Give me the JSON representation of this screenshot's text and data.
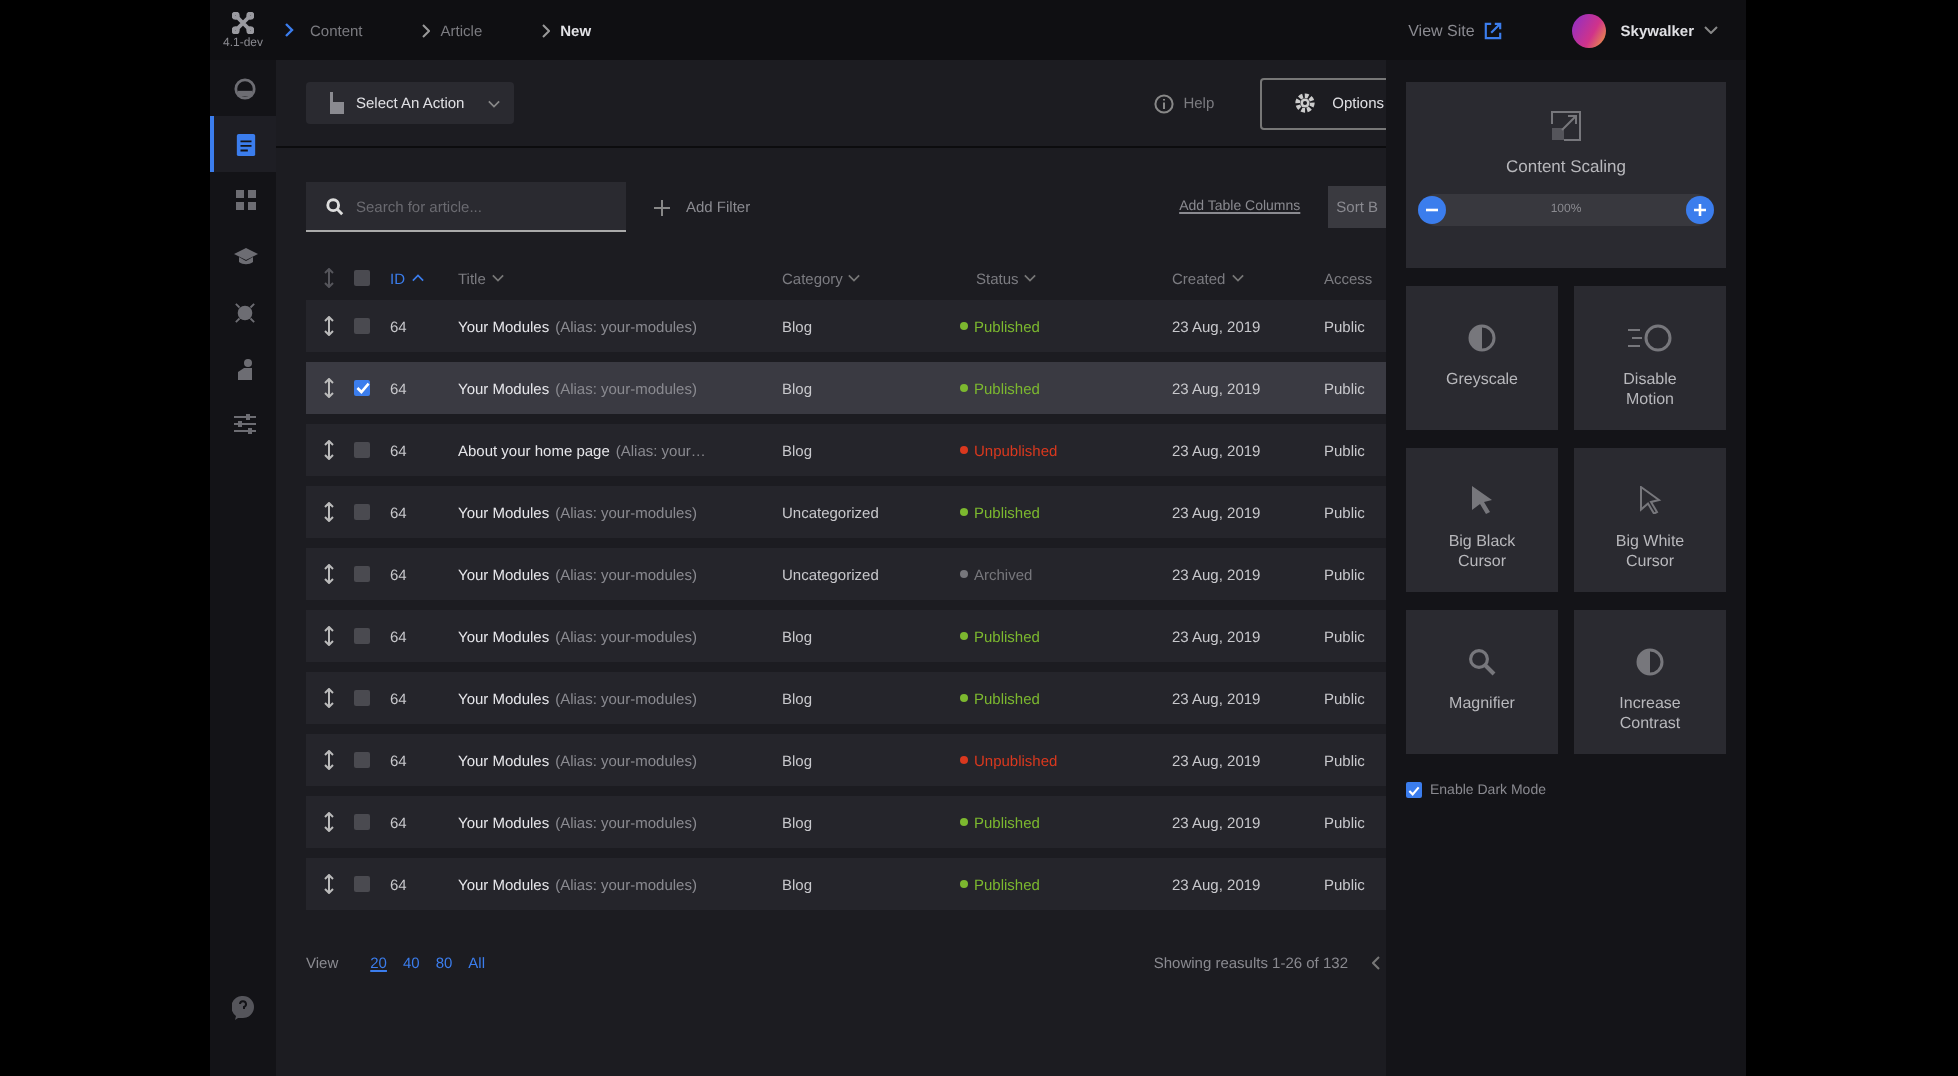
{
  "brand": {
    "version": "4.1-dev"
  },
  "breadcrumbs": [
    {
      "label": "Content",
      "current": false
    },
    {
      "label": "Article",
      "current": false
    },
    {
      "label": "New",
      "current": true
    }
  ],
  "header_right": {
    "view_site": "View Site",
    "user": "Skywalker"
  },
  "sidebar": {
    "items": [
      {
        "kind": "gauge",
        "selected": false
      },
      {
        "kind": "article",
        "selected": true
      },
      {
        "kind": "grid",
        "selected": false
      },
      {
        "kind": "cap",
        "selected": false
      },
      {
        "kind": "bug",
        "selected": false
      },
      {
        "kind": "user",
        "selected": false
      },
      {
        "kind": "sliders",
        "selected": false
      }
    ]
  },
  "toolbar": {
    "action": "Select An Action",
    "help": "Help",
    "options": "Options"
  },
  "filters": {
    "search_placeholder": "Search for article...",
    "add_filter": "Add Filter",
    "add_columns": "Add Table Columns",
    "sort": "Sort B"
  },
  "table": {
    "header_checked": false,
    "columns": [
      {
        "label": "ID",
        "sorted": true
      },
      {
        "label": "Title",
        "sorted": false
      },
      {
        "label": "Category",
        "sorted": false
      },
      {
        "label": "Status",
        "sorted": false
      },
      {
        "label": "Created",
        "sorted": false
      },
      {
        "label": "Access",
        "sorted": false
      }
    ],
    "rows": [
      {
        "selected": false,
        "id": "64",
        "title": "Your Modules",
        "alias": "(Alias: your-modules)",
        "category": "Blog",
        "status": "Published",
        "color": "#7cb82f",
        "created": "23 Aug, 2019",
        "access": "Public"
      },
      {
        "selected": true,
        "id": "64",
        "title": "Your Modules",
        "alias": "(Alias: your-modules)",
        "category": "Blog",
        "status": "Published",
        "color": "#7cb82f",
        "created": "23 Aug, 2019",
        "access": "Public"
      },
      {
        "selected": false,
        "id": "64",
        "title": "About your home page",
        "alias": "(Alias: your…",
        "category": "Blog",
        "status": "Unpublished",
        "color": "#d9381e",
        "created": "23 Aug, 2019",
        "access": "Public"
      },
      {
        "selected": false,
        "id": "64",
        "title": "Your Modules",
        "alias": "(Alias: your-modules)",
        "category": "Uncategorized",
        "status": "Published",
        "color": "#7cb82f",
        "created": "23 Aug, 2019",
        "access": "Public"
      },
      {
        "selected": false,
        "id": "64",
        "title": "Your Modules",
        "alias": "(Alias: your-modules)",
        "category": "Uncategorized",
        "status": "Archived",
        "color": "#77777c",
        "created": "23 Aug, 2019",
        "access": "Public"
      },
      {
        "selected": false,
        "id": "64",
        "title": "Your Modules",
        "alias": "(Alias: your-modules)",
        "category": "Blog",
        "status": "Published",
        "color": "#7cb82f",
        "created": "23 Aug, 2019",
        "access": "Public"
      },
      {
        "selected": false,
        "id": "64",
        "title": "Your Modules",
        "alias": "(Alias: your-modules)",
        "category": "Blog",
        "status": "Published",
        "color": "#7cb82f",
        "created": "23 Aug, 2019",
        "access": "Public"
      },
      {
        "selected": false,
        "id": "64",
        "title": "Your Modules",
        "alias": "(Alias: your-modules)",
        "category": "Blog",
        "status": "Unpublished",
        "color": "#d9381e",
        "created": "23 Aug, 2019",
        "access": "Public"
      },
      {
        "selected": false,
        "id": "64",
        "title": "Your Modules",
        "alias": "(Alias: your-modules)",
        "category": "Blog",
        "status": "Published",
        "color": "#7cb82f",
        "created": "23 Aug, 2019",
        "access": "Public"
      },
      {
        "selected": false,
        "id": "64",
        "title": "Your Modules",
        "alias": "(Alias: your-modules)",
        "category": "Blog",
        "status": "Published",
        "color": "#7cb82f",
        "created": "23 Aug, 2019",
        "access": "Public"
      }
    ]
  },
  "pagination": {
    "view": "View",
    "sizes": [
      {
        "label": "20",
        "selected": true
      },
      {
        "label": "40",
        "selected": false
      },
      {
        "label": "80",
        "selected": false
      },
      {
        "label": "All",
        "selected": false
      }
    ],
    "showing": "Showing reasults 1-26 of 132"
  },
  "accessibility_panel": {
    "scaling": {
      "title": "Content Scaling",
      "reading": "100%"
    },
    "tiles": [
      {
        "kind": "greyscale",
        "label": "Greyscale"
      },
      {
        "kind": "motion",
        "label": "Disable Motion"
      },
      {
        "kind": "black-cursor",
        "label": "Big Black Cursor"
      },
      {
        "kind": "white-cursor",
        "label": "Big White Cursor"
      },
      {
        "kind": "magnifier",
        "label": "Magnifier"
      },
      {
        "kind": "contrast",
        "label": "Increase Contrast"
      }
    ],
    "dark_mode": {
      "label": "Enable Dark Mode",
      "checked": true
    }
  }
}
